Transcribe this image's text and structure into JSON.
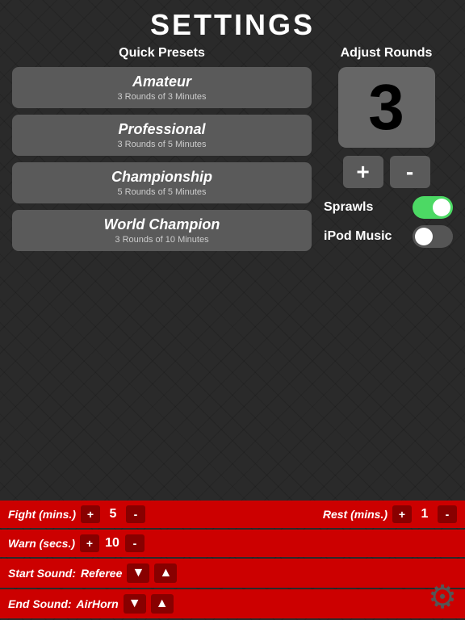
{
  "header": {
    "title": "SETTINGS"
  },
  "quick_presets": {
    "section_title": "Quick Presets",
    "presets": [
      {
        "label": "Amateur",
        "sub": "3 Rounds of 3 Minutes"
      },
      {
        "label": "Professional",
        "sub": "3 Rounds of 5 Minutes"
      },
      {
        "label": "Championship",
        "sub": "5 Rounds of 5 Minutes"
      },
      {
        "label": "World Champion",
        "sub": "3 Rounds of 10 Minutes"
      }
    ]
  },
  "adjust_rounds": {
    "section_title": "Adjust Rounds",
    "value": "3",
    "plus_label": "+",
    "minus_label": "-"
  },
  "toggles": [
    {
      "label": "Sprawls",
      "state": "on"
    },
    {
      "label": "iPod Music",
      "state": "off"
    }
  ],
  "bottom_bars": {
    "fight": {
      "label": "Fight (mins.)",
      "value": "5"
    },
    "rest": {
      "label": "Rest (mins.)",
      "value": "1"
    },
    "warn": {
      "label": "Warn (secs.)",
      "value": "10"
    },
    "start_sound": {
      "label": "Start Sound:",
      "value": "Referee"
    },
    "end_sound": {
      "label": "End Sound:",
      "value": "AirHorn"
    }
  }
}
